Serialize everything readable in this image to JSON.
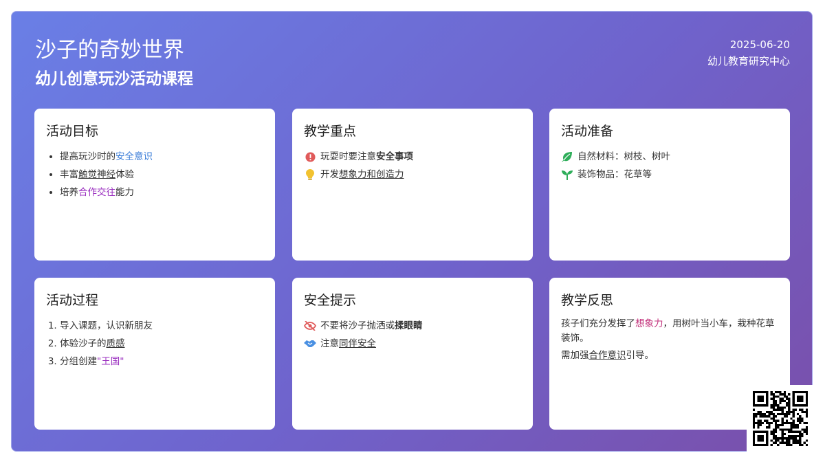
{
  "header": {
    "title": "沙子的奇妙世界",
    "subtitle": "幼儿创意玩沙活动课程",
    "date": "2025-06-20",
    "org": "幼儿教育研究中心"
  },
  "cards": {
    "goals": {
      "title": "活动目标",
      "items": [
        {
          "pre": "提高玩沙时的",
          "hl": "安全意识",
          "post": ""
        },
        {
          "pre": "丰富",
          "hl": "触觉神经",
          "post": "体验"
        },
        {
          "pre": "培养",
          "hl": "合作交往",
          "post": "能力"
        }
      ]
    },
    "focus": {
      "title": "教学重点",
      "items": [
        {
          "icon": "alert-icon",
          "pre": "玩耍时要注意",
          "hl": "安全事项",
          "post": ""
        },
        {
          "icon": "lightbulb-icon",
          "pre": "开发",
          "hl": "想象力和创造力",
          "post": ""
        }
      ]
    },
    "prep": {
      "title": "活动准备",
      "items": [
        {
          "icon": "leaf-icon",
          "text": "自然材料：树枝、树叶"
        },
        {
          "icon": "seedling-icon",
          "text": "装饰物品：花草等"
        }
      ]
    },
    "process": {
      "title": "活动过程",
      "items": [
        {
          "pre": "导入课题，认识新朋友",
          "hl": "",
          "post": ""
        },
        {
          "pre": "体验沙子的",
          "hl": "质感",
          "post": ""
        },
        {
          "pre": "分组创建",
          "hl": "\"王国\"",
          "post": ""
        }
      ]
    },
    "safety": {
      "title": "安全提示",
      "items": [
        {
          "icon": "eye-slash-icon",
          "pre": "不要将沙子抛洒或",
          "hl": "揉眼睛",
          "post": ""
        },
        {
          "icon": "handshake-icon",
          "pre": "注意",
          "hl": "同伴安全",
          "post": ""
        }
      ]
    },
    "reflection": {
      "title": "教学反思",
      "p1_pre": "孩子们充分发挥了",
      "p1_hl": "想象力",
      "p1_post": "，用树叶当小车，栽种花草装饰。",
      "p2_pre": "需加强",
      "p2_hl": "合作意识",
      "p2_post": "引导。"
    }
  },
  "colors": {
    "gradient_start": "#6a7fe6",
    "gradient_end": "#7a4faa",
    "highlight_blue": "#3b7dd8",
    "highlight_purple": "#9b30c0",
    "highlight_pink": "#c2307a",
    "alert_red": "#e05a5a",
    "bulb_yellow": "#f2c230",
    "leaf_green": "#2fae5a"
  }
}
